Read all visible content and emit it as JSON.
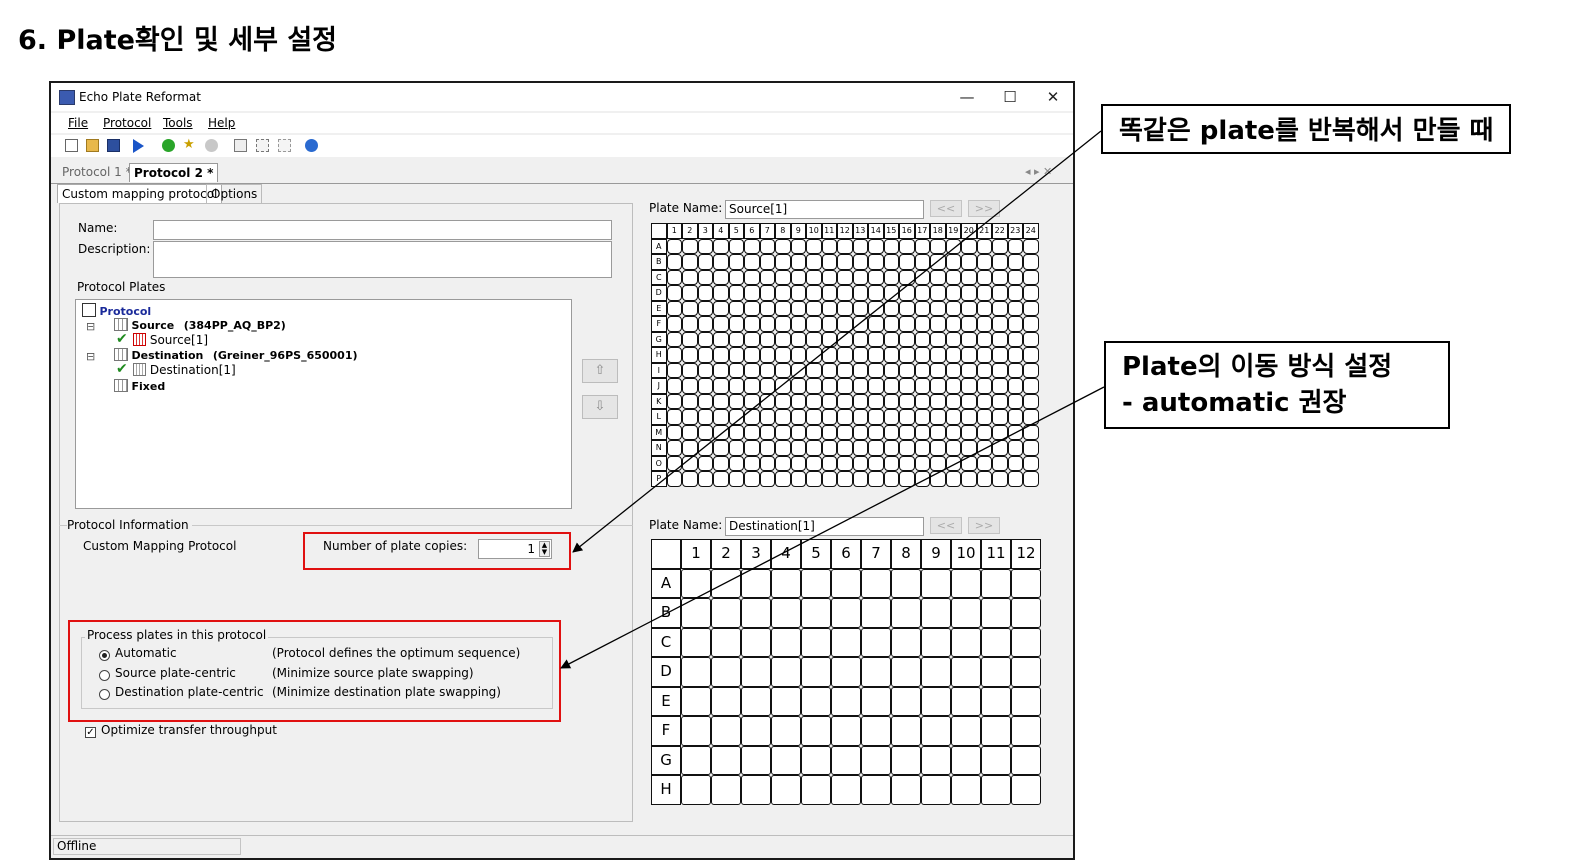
{
  "heading": "6. Plate확인 및 세부 설정",
  "window": {
    "title": "Echo Plate Reformat",
    "controls": {
      "minimize": "—",
      "maximize": "☐",
      "close": "✕"
    },
    "menu": [
      "File",
      "Protocol",
      "Tools",
      "Help"
    ],
    "toolbar_icons": [
      "new-icon",
      "open-icon",
      "save-icon",
      "run-icon",
      "add-icon",
      "favorite-icon",
      "stop-icon",
      "grid-icon",
      "map-icon",
      "transfer-icon",
      "help-icon"
    ],
    "doc_tabs": [
      "Protocol 1 *",
      "Protocol 2 *"
    ],
    "tab_nav": "◂ ▸ ✕",
    "sub_tabs": [
      "Custom mapping protocol",
      "Options"
    ],
    "form": {
      "name_label": "Name:",
      "name_value": "",
      "description_label": "Description:",
      "description_value": "",
      "plates_label": "Protocol Plates"
    },
    "tree": {
      "root": "Protocol",
      "source": "Source",
      "source_type": "(384PP_AQ_BP2)",
      "source_child": "Source[1]",
      "destination": "Destination",
      "destination_type": "(Greiner_96PS_650001)",
      "destination_child": "Destination[1]",
      "fixed": "Fixed"
    },
    "move_up": "⇧",
    "move_down": "⇩",
    "protocol_info": {
      "group_label": "Protocol Information",
      "type_label": "Custom Mapping Protocol",
      "copies_label": "Number of plate copies:",
      "copies_value": "1"
    },
    "process": {
      "group_label": "Process plates in this protocol",
      "options": [
        {
          "label": "Automatic",
          "desc": "(Protocol defines the optimum sequence)",
          "selected": true
        },
        {
          "label": "Source plate-centric",
          "desc": "(Minimize source plate swapping)",
          "selected": false
        },
        {
          "label": "Destination plate-centric",
          "desc": "(Minimize destination plate swapping)",
          "selected": false
        }
      ]
    },
    "optimize": {
      "label": "Optimize transfer throughput",
      "checked": true
    },
    "source_plate": {
      "name_label": "Plate Name:",
      "name_value": "Source[1]",
      "prev": "<<",
      "next": ">>",
      "columns": [
        "1",
        "2",
        "3",
        "4",
        "5",
        "6",
        "7",
        "8",
        "9",
        "10",
        "11",
        "12",
        "13",
        "14",
        "15",
        "16",
        "17",
        "18",
        "19",
        "20",
        "21",
        "22",
        "23",
        "24"
      ],
      "rows": [
        "A",
        "B",
        "C",
        "D",
        "E",
        "F",
        "G",
        "H",
        "I",
        "J",
        "K",
        "L",
        "M",
        "N",
        "O",
        "P"
      ]
    },
    "dest_plate": {
      "name_label": "Plate Name:",
      "name_value": "Destination[1]",
      "prev": "<<",
      "next": ">>",
      "columns": [
        "1",
        "2",
        "3",
        "4",
        "5",
        "6",
        "7",
        "8",
        "9",
        "10",
        "11",
        "12"
      ],
      "rows": [
        "A",
        "B",
        "C",
        "D",
        "E",
        "F",
        "G",
        "H"
      ]
    },
    "status": "Offline"
  },
  "callouts": {
    "copies": "똑같은 plate를 반복해서 만들 때",
    "process_line1": "Plate의 이동 방식 설정",
    "process_line2": "- automatic 권장"
  },
  "colors": {
    "highlight": "#e01010",
    "tree_text": "#1a2a9a",
    "check": "#1f8a1f"
  }
}
